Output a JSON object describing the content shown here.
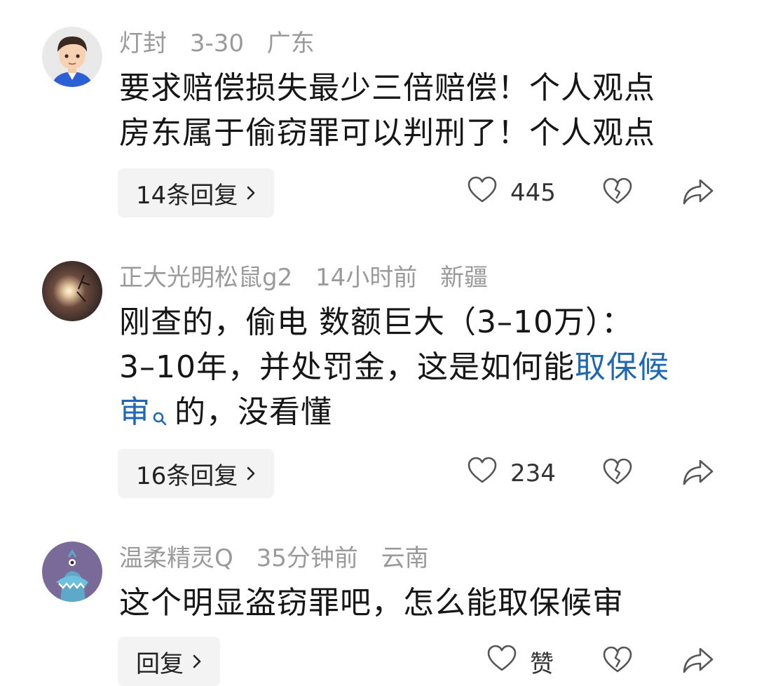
{
  "comments": [
    {
      "user": "灯封",
      "date": "3-30",
      "region": "广东",
      "lines": [
        "要求赔偿损失最少三倍赔偿！个人观点",
        "房东属于偷窃罪可以判刑了！个人观点"
      ],
      "reply_label": "14条回复",
      "likes": "445"
    },
    {
      "user": "正大光明松鼠g2",
      "date": "14小时前",
      "region": "新疆",
      "line1": "刚查的，偷电 数额巨大（3–10万）：",
      "line2_text": "3–10年，并处罚金，这是如何能",
      "line2_link": "取保候",
      "line3_link": "审",
      "line3_text": "的，没看懂",
      "reply_label": "16条回复",
      "likes": "234"
    },
    {
      "user": "温柔精灵Q",
      "date": "35分钟前",
      "region": "云南",
      "lines": [
        "这个明显盗窃罪吧，怎么能取保候审"
      ],
      "reply_label": "回复",
      "likes": "赞"
    }
  ],
  "colors": {
    "link": "#1f66b3",
    "meta": "#9a9a9a",
    "text": "#161616",
    "reply_bg": "#f3f3f3"
  },
  "icons": [
    "heart-icon",
    "broken-heart-icon",
    "share-icon",
    "chevron-right-icon",
    "search-icon"
  ]
}
